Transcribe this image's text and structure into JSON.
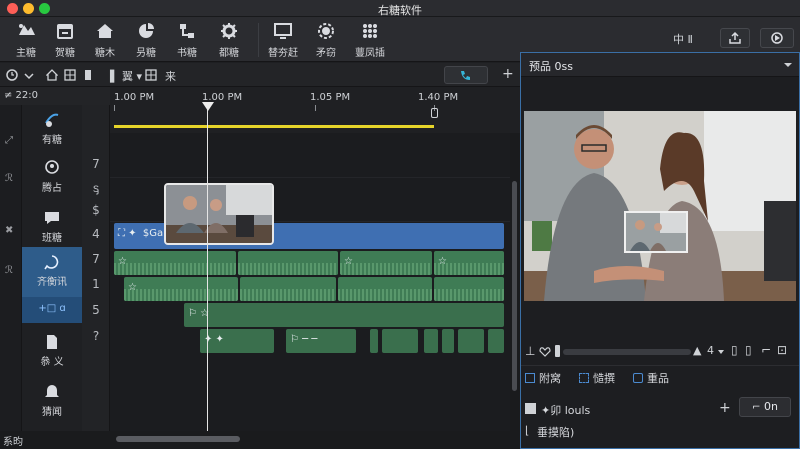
{
  "window": {
    "title": "右糖软件"
  },
  "toolbar": {
    "items": [
      {
        "label": "主糖",
        "icon": "add-media-icon"
      },
      {
        "label": "贺糖",
        "icon": "calendar-icon"
      },
      {
        "label": "糖木",
        "icon": "home-icon"
      },
      {
        "label": "叧糖",
        "icon": "pie-icon"
      },
      {
        "label": "书糖",
        "icon": "flow-icon"
      },
      {
        "label": "都糖",
        "icon": "gear-icon"
      },
      {
        "label": "替夯赶",
        "icon": "monitor-icon"
      },
      {
        "label": "矛窃",
        "icon": "settings-icon"
      },
      {
        "label": "蘴凤插",
        "icon": "grid-icon"
      }
    ],
    "right_glyphs": "中 Ⅱ"
  },
  "left": {
    "time": "≠ 22:0",
    "side_glyphs": [
      "⤢",
      "ℛ",
      "✖",
      "ℛ"
    ],
    "tracks": [
      {
        "label": "有糖",
        "icon": "text-icon"
      },
      {
        "label": "腾占",
        "icon": "face-icon"
      },
      {
        "label": "班糖",
        "icon": "speech-icon"
      },
      {
        "label": "齐衡讯",
        "icon": "audio-icon"
      },
      {
        "label": "+□ ɑ",
        "icon": "clip-icon"
      },
      {
        "label": "叅 义",
        "icon": "document-icon"
      },
      {
        "label": "猜闻",
        "icon": "bell-icon"
      }
    ],
    "numbers": [
      "7",
      "ᶊ",
      "$",
      "4",
      "7",
      "1",
      "5",
      "?"
    ],
    "status": "系昀"
  },
  "timeline": {
    "ticks": [
      "1.00 PM",
      "1.00 PM",
      "1.05 PM",
      "1.40 PM"
    ],
    "clip_blue_label": "⛶ ✦  $Gan",
    "clip_green_labels": [
      "☆",
      "☆",
      "☆",
      "☆",
      "☆"
    ],
    "clip_small_labels": [
      "⚐ ☆",
      "✦ ✦",
      "⚐ ─ ─"
    ]
  },
  "preview": {
    "title": "预品 0ss",
    "tabs": [
      {
        "label": "附窝"
      },
      {
        "label": "慥撰"
      },
      {
        "label": "重品"
      }
    ],
    "speed": "4",
    "row1_label": "✦卯 louls",
    "row2_label": "垂摸陷)",
    "on_button": "0n"
  }
}
